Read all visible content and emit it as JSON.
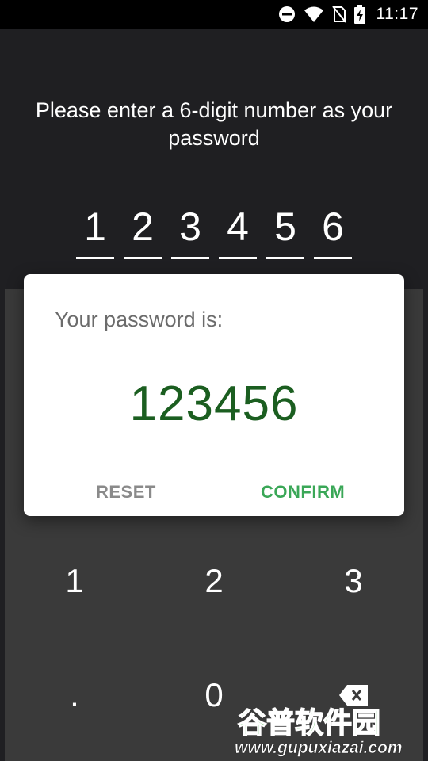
{
  "status_bar": {
    "time": "11:17",
    "icons": [
      "do-not-disturb-icon",
      "wifi-icon",
      "no-sim-icon",
      "battery-charging-icon"
    ]
  },
  "prompt": {
    "text": "Please enter a 6-digit number as your password"
  },
  "digits": [
    "1",
    "2",
    "3",
    "4",
    "5",
    "6"
  ],
  "keypad": {
    "keys": [
      "1",
      "2",
      "3",
      ".",
      "0"
    ],
    "backspace_icon": "backspace-icon"
  },
  "dialog": {
    "title": "Your password is:",
    "value": "123456",
    "reset_label": "RESET",
    "confirm_label": "CONFIRM"
  },
  "watermark": {
    "logo": "谷普软件园",
    "url": "www.gupuxiazai.com"
  },
  "colors": {
    "background": "#1f1f22",
    "keypad": "#3a3a3a",
    "dialog_value": "#1b5e20",
    "confirm": "#3aa757",
    "reset": "#8a8a8a"
  }
}
